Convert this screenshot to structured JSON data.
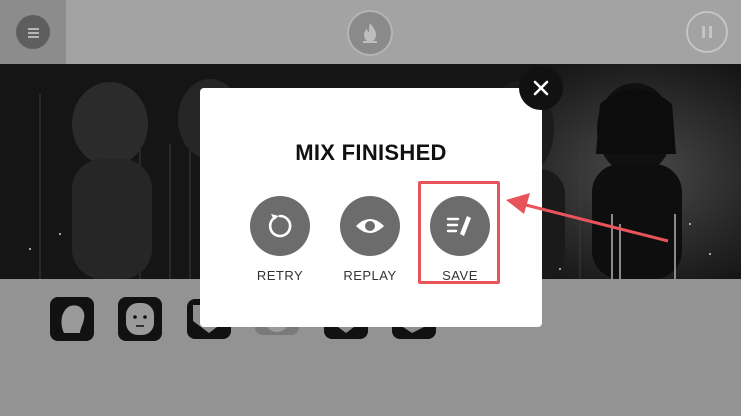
{
  "topbar": {
    "menu_icon": "hamburger-icon",
    "center_icon": "flame-icon",
    "pause_icon": "pause-icon"
  },
  "tray": {
    "slots": [
      {
        "icon": "head-silhouette-icon"
      },
      {
        "icon": "face-icon"
      },
      {
        "icon": "shield-icon"
      },
      {
        "icon": "circle-face-icon"
      },
      {
        "icon": "shield-icon"
      },
      {
        "icon": "blob-icon"
      }
    ]
  },
  "modal": {
    "title": "MIX FINISHED",
    "actions": [
      {
        "label": "RETRY",
        "icon": "retry-icon"
      },
      {
        "label": "REPLAY",
        "icon": "eye-icon"
      },
      {
        "label": "SAVE",
        "icon": "save-pencil-icon"
      }
    ],
    "close_icon": "close-icon"
  },
  "annotation": {
    "highlight_color": "#e8545a",
    "arrow_color": "#e8545a"
  }
}
